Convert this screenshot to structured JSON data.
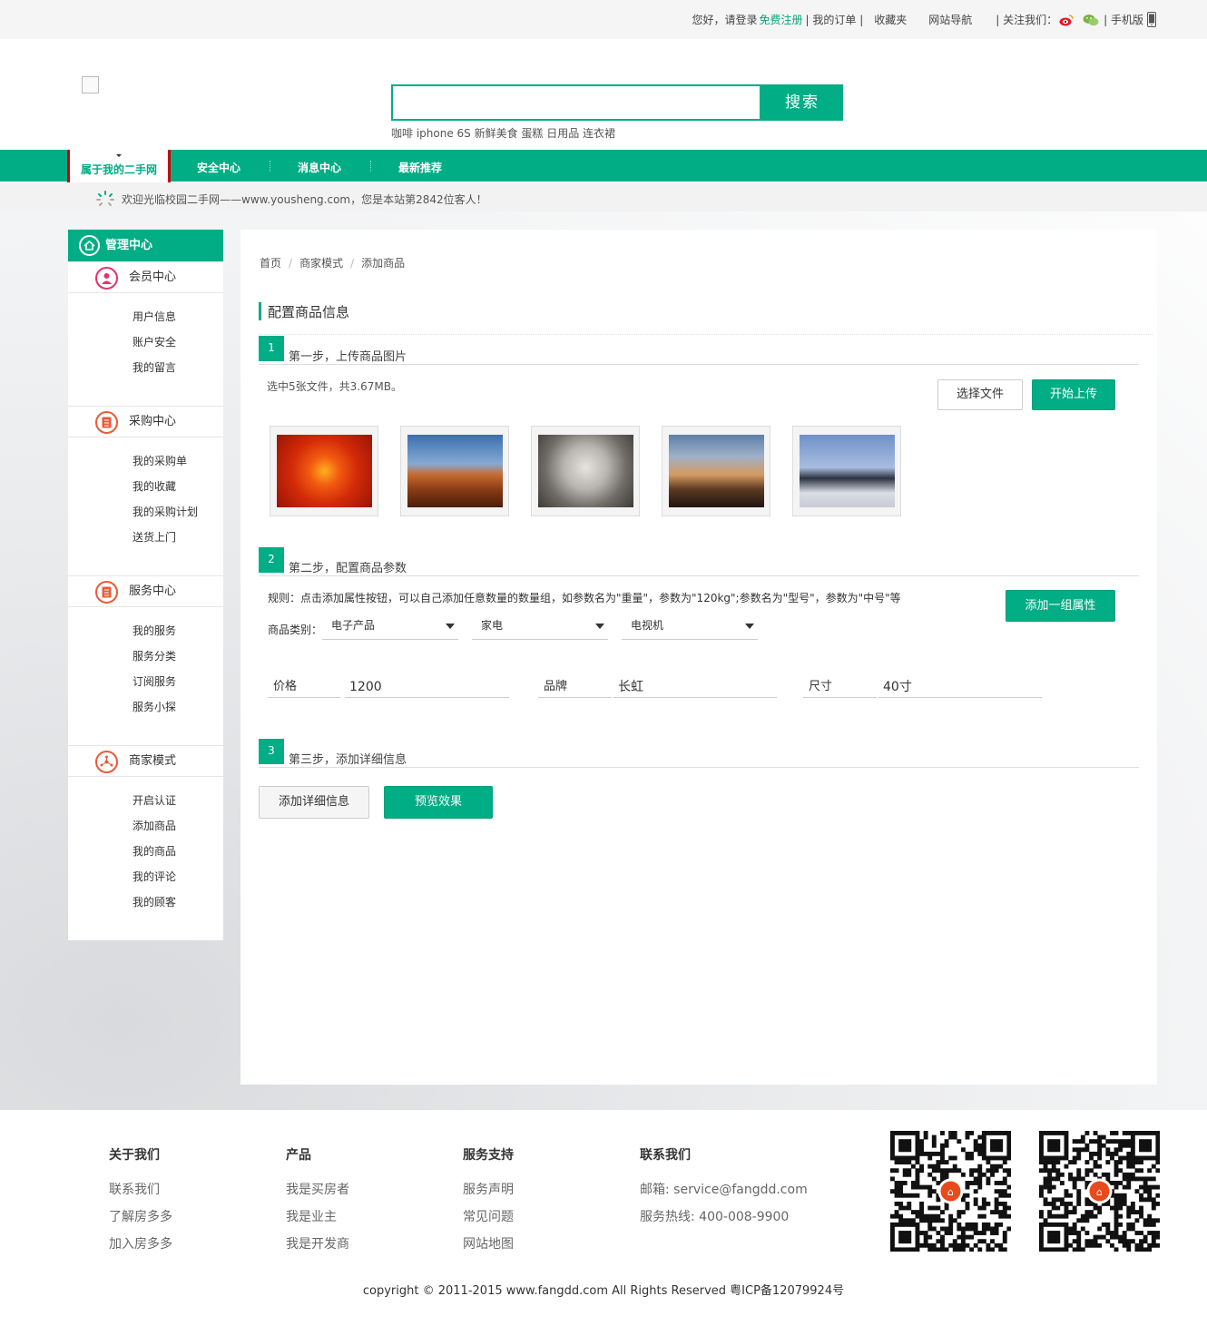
{
  "topbar": {
    "greeting": "您好，请登录",
    "register": "免费注册",
    "my_orders": "| 我的订单 |",
    "favorites": "收藏夹",
    "site_nav": "网站导航",
    "follow_us": "| 关注我们：",
    "mobile": "| 手机版"
  },
  "search": {
    "placeholder": "",
    "button": "搜索",
    "hotwords": "咖啡 iphone 6S 新鲜美食 蛋糕 日用品 连衣裙"
  },
  "nav": {
    "active": "属于我的二手网",
    "items": [
      "安全中心",
      "消息中心",
      "最新推荐"
    ]
  },
  "notice": "欢迎光临校园二手网——www.yousheng.com，您是本站第2842位客人！",
  "sidebar": {
    "header": "管理中心",
    "sections": [
      {
        "title": "会员中心",
        "links": [
          "用户信息",
          "账户安全",
          "我的留言"
        ]
      },
      {
        "title": "采购中心",
        "links": [
          "我的采购单",
          "我的收藏",
          "我的采购计划",
          "送货上门"
        ]
      },
      {
        "title": "服务中心",
        "links": [
          "我的服务",
          "服务分类",
          "订阅服务",
          "服务小探"
        ]
      },
      {
        "title": "商家模式",
        "links": [
          "开启认证",
          "添加商品",
          "我的商品",
          "我的评论",
          "我的顾客"
        ]
      }
    ],
    "active_link": "添加商品"
  },
  "breadcrumb": [
    "首页",
    "商家模式",
    "添加商品"
  ],
  "main": {
    "title": "配置商品信息",
    "step1": {
      "num": "1",
      "title": "第一步，上传商品图片",
      "selected": "选中5张文件，共3.67MB。",
      "choose_btn": "选择文件",
      "upload_btn": "开始上传"
    },
    "step2": {
      "num": "2",
      "title": "第二步，配置商品参数",
      "rule": "规则：点击添加属性按钮，可以自己添加任意数量的数量组，如参数名为\"重量\"，参数为\"120kg\";参数名为\"型号\"，参数为\"中号\"等",
      "add_btn": "添加一组属性",
      "category_label": "商品类别：",
      "categories": [
        "电子产品",
        "家电",
        "电视机"
      ],
      "params": [
        {
          "name": "价格",
          "value": "1200"
        },
        {
          "name": "品牌",
          "value": "长虹"
        },
        {
          "name": "尺寸",
          "value": "40寸"
        }
      ]
    },
    "step3": {
      "num": "3",
      "title": "第三步，添加详细信息",
      "detail_btn": "添加详细信息",
      "preview_btn": "预览效果"
    }
  },
  "footer": {
    "cols": [
      {
        "head": "关于我们",
        "links": [
          "联系我们",
          "了解房多多",
          "加入房多多"
        ]
      },
      {
        "head": "产品",
        "links": [
          "我是买房者",
          "我是业主",
          "我是开发商"
        ]
      },
      {
        "head": "服务支持",
        "links": [
          "服务声明",
          "常见问题",
          "网站地图"
        ]
      },
      {
        "head": "联系我们",
        "links": [
          "邮箱: service@fangdd.com",
          "服务热线: 400-008-9900"
        ]
      }
    ],
    "copyright": "copyright © 2011-2015 www.fangdd.com All Rights Reserved 粤ICP备12079924号"
  },
  "colors": {
    "accent": "#00ad85",
    "icon": "#e95b3a"
  }
}
